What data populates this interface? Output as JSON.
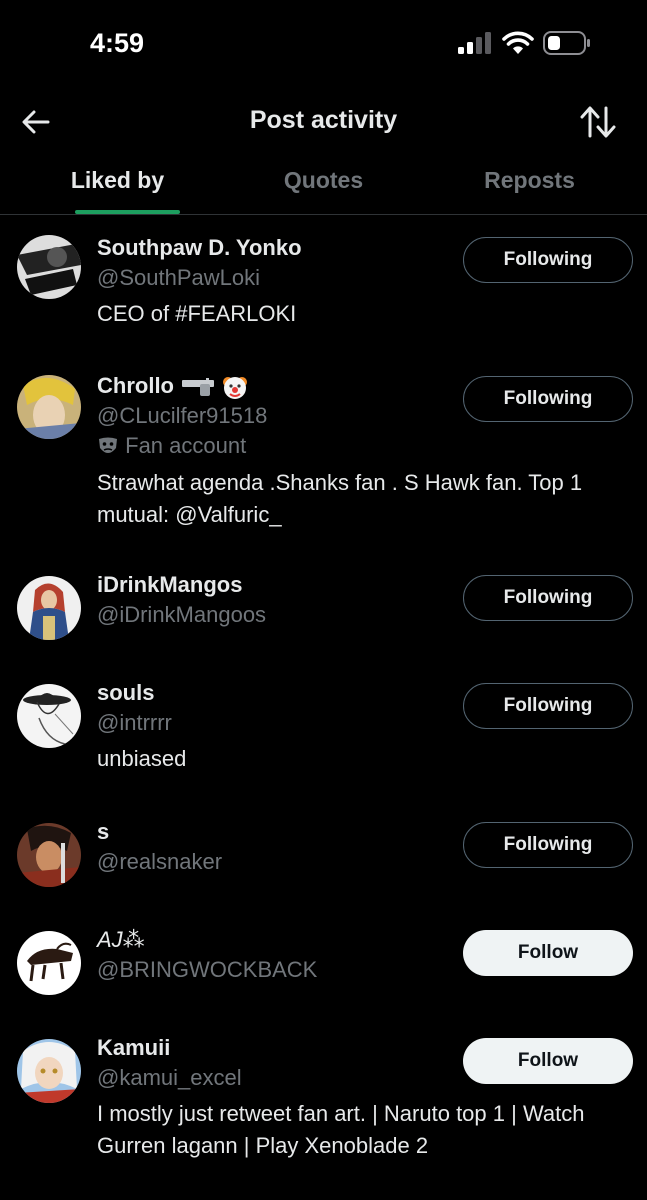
{
  "status_bar": {
    "time": "4:59"
  },
  "header": {
    "title": "Post activity"
  },
  "tabs": [
    {
      "label": "Liked by",
      "active": true
    },
    {
      "label": "Quotes",
      "active": false
    },
    {
      "label": "Reposts",
      "active": false
    }
  ],
  "users": [
    {
      "name": "Southpaw D. Yonko",
      "handle": "@SouthPawLoki",
      "bio": "CEO of #FEARLOKI",
      "button": "Following"
    },
    {
      "name": "Chrollo",
      "name_icons": [
        "pistol-emoji",
        "clown-emoji"
      ],
      "handle": "@CLucilfer91518",
      "label_icon": "masks-icon",
      "label": "Fan account",
      "bio": "Strawhat agenda .Shanks fan . S Hawk fan. Top 1 mutual: @Valfuric_",
      "button": "Following"
    },
    {
      "name": "iDrinkMangos",
      "handle": "@iDrinkMangoos",
      "bio": "",
      "button": "Following"
    },
    {
      "name": "souls",
      "handle": "@intrrrr",
      "bio": "unbiased",
      "button": "Following"
    },
    {
      "name": "s",
      "handle": "@realsnaker",
      "bio": "",
      "button": "Following"
    },
    {
      "name": "AJ⁂",
      "handle": "@BRINGWOCKBACK",
      "bio": "",
      "button": "Follow"
    },
    {
      "name": "Kamuii",
      "handle": "@kamui_excel",
      "bio": "I mostly just retweet fan art. | Naruto top 1 | Watch Gurren lagann | Play Xenoblade 2",
      "button": "Follow"
    }
  ]
}
